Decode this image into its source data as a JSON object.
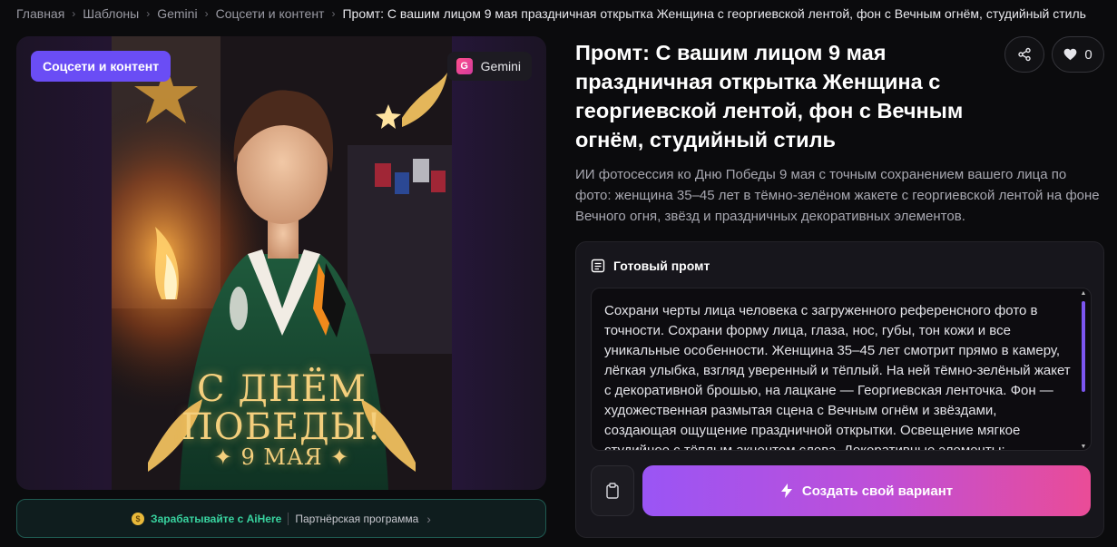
{
  "breadcrumb": {
    "items": [
      "Главная",
      "Шаблоны",
      "Gemini",
      "Соцсети и контент"
    ],
    "separator": "›",
    "current": "Промт: С вашим лицом 9 мая праздничная открытка Женщина с георгиевской лентой, фон с Вечным огнём, студийный стиль"
  },
  "preview": {
    "category_chip": "Соцсети и контент",
    "model_chip": {
      "icon_letter": "G",
      "label": "Gemini"
    },
    "greeting_line1": "С ДНЁМ",
    "greeting_line2": "ПОБЕДЫ!",
    "greeting_line3": "✦ 9 МАЯ ✦"
  },
  "promo": {
    "icon": "coin-icon",
    "earn": "Зарабатывайте с AiHere",
    "partner": "Партнёрская программа"
  },
  "title": "Промт: С вашим лицом 9 мая праздничная открытка Женщина с георгиевской лентой, фон с Вечным огнём, студийный стиль",
  "actions": {
    "share_icon": "share-icon",
    "like_icon": "heart-icon",
    "like_count": "0"
  },
  "description": "ИИ фотосессия ко Дню Победы 9 мая с точным сохранением вашего лица по фото: женщина 35–45 лет в тёмно-зелёном жакете с георгиевской лентой на фоне Вечного огня, звёзд и праздничных декоративных элементов.",
  "prompt": {
    "header": "Готовый промт",
    "text": "Сохрани черты лица человека с загруженного референсного фото в точности. Сохрани форму лица, глаза, нос, губы, тон кожи и все уникальные особенности. Женщина 35–45 лет смотрит прямо в камеру, лёгкая улыбка, взгляд уверенный и тёплый. На ней тёмно-зелёный жакет с декоративной брошью, на лацкане — Георгиевская ленточка. Фон — художественная размытая сцена с Вечным огнём и звёздами, создающая ощущение праздничной открытки. Освещение мягкое студийное с тёплым акцентом слева. Декоративные элементы:",
    "create_button": "Создать свой вариант"
  },
  "colors": {
    "accent": "#6a4df5",
    "button_gradient_start": "#9a55f5",
    "button_gradient_end": "#ea4c97",
    "promo_green": "#38d39f",
    "gold": "#f4cf7d"
  }
}
